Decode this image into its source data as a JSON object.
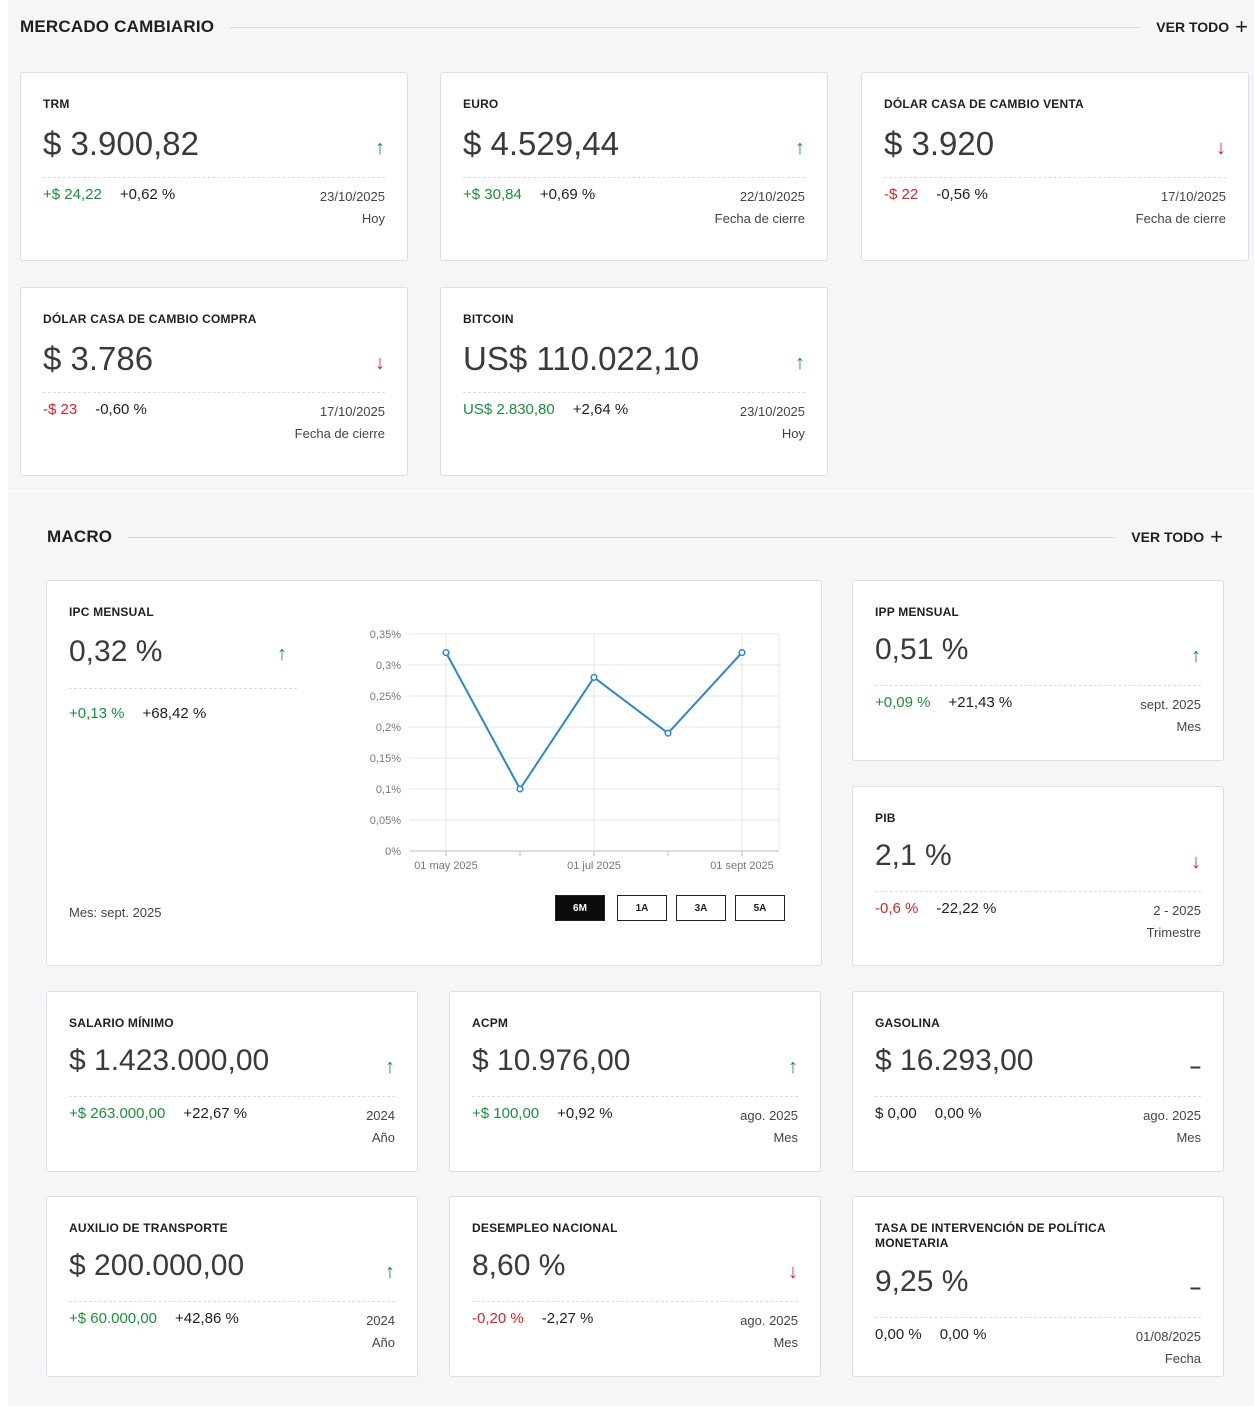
{
  "mercado": {
    "title": "MERCADO CAMBIARIO",
    "ver_todo": "VER TODO",
    "cards": [
      {
        "title": "TRM",
        "value": "$ 3.900,82",
        "trend": "up",
        "abs": "+$ 24,22",
        "pct": "+0,62 %",
        "date": "23/10/2025",
        "sub": "Hoy"
      },
      {
        "title": "EURO",
        "value": "$ 4.529,44",
        "trend": "up",
        "abs": "+$ 30,84",
        "pct": "+0,69 %",
        "date": "22/10/2025",
        "sub": "Fecha de cierre"
      },
      {
        "title": "DÓLAR CASA DE CAMBIO VENTA",
        "value": "$ 3.920",
        "trend": "down",
        "abs": "-$ 22",
        "pct": "-0,56 %",
        "date": "17/10/2025",
        "sub": "Fecha de cierre"
      },
      {
        "title": "DÓLAR CASA DE CAMBIO COMPRA",
        "value": "$ 3.786",
        "trend": "down",
        "abs": "-$ 23",
        "pct": "-0,60 %",
        "date": "17/10/2025",
        "sub": "Fecha de cierre"
      },
      {
        "title": "BITCOIN",
        "value": "US$ 110.022,10",
        "trend": "up",
        "abs": "US$ 2.830,80",
        "pct": "+2,64 %",
        "date": "23/10/2025",
        "sub": "Hoy"
      }
    ]
  },
  "macro": {
    "title": "MACRO",
    "ver_todo": "VER TODO",
    "ipc": {
      "title": "IPC MENSUAL",
      "value": "0,32 %",
      "trend": "up",
      "abs": "+0,13 %",
      "pct": "+68,42 %",
      "mes": "Mes: sept. 2025",
      "ranges": [
        "6M",
        "1A",
        "3A",
        "5A"
      ],
      "active_range": "6M"
    },
    "cards": [
      {
        "title": "IPP MENSUAL",
        "value": "0,51 %",
        "trend": "up",
        "abs": "+0,09 %",
        "pct": "+21,43 %",
        "date": "sept. 2025",
        "sub": "Mes"
      },
      {
        "title": "PIB",
        "value": "2,1 %",
        "trend": "down",
        "abs": "-0,6 %",
        "pct": "-22,22 %",
        "date": "2 - 2025",
        "sub": "Trimestre"
      },
      {
        "title": "SALARIO MÍNIMO",
        "value": "$ 1.423.000,00",
        "trend": "up",
        "abs": "+$ 263.000,00",
        "pct": "+22,67 %",
        "date": "2024",
        "sub": "Año"
      },
      {
        "title": "ACPM",
        "value": "$ 10.976,00",
        "trend": "up",
        "abs": "+$ 100,00",
        "pct": "+0,92 %",
        "date": "ago. 2025",
        "sub": "Mes"
      },
      {
        "title": "GASOLINA",
        "value": "$ 16.293,00",
        "trend": "flat",
        "abs": "$ 0,00",
        "pct": "0,00 %",
        "date": "ago. 2025",
        "sub": "Mes"
      },
      {
        "title": "AUXILIO DE TRANSPORTE",
        "value": "$ 200.000,00",
        "trend": "up",
        "abs": "+$ 60.000,00",
        "pct": "+42,86 %",
        "date": "2024",
        "sub": "Año"
      },
      {
        "title": "DESEMPLEO NACIONAL",
        "value": "8,60 %",
        "trend": "down",
        "abs": "-0,20 %",
        "pct": "-2,27 %",
        "date": "ago. 2025",
        "sub": "Mes"
      },
      {
        "title": "TASA DE INTERVENCIÓN DE POLÍTICA MONETARIA",
        "value": "9,25 %",
        "trend": "flat",
        "abs": "0,00 %",
        "pct": "0,00 %",
        "date": "01/08/2025",
        "sub": "Fecha"
      }
    ]
  },
  "chart_data": {
    "type": "line",
    "x": [
      "01 may 2025",
      "01 jun 2025",
      "01 jul 2025",
      "01 ago 2025",
      "01 sept 2025"
    ],
    "x_tick_labels": [
      "01 may 2025",
      "01 jul 2025",
      "01 sept 2025"
    ],
    "series": [
      {
        "values": [
          0.32,
          0.1,
          0.28,
          0.19,
          0.32
        ]
      }
    ],
    "y_tick_labels": [
      "0%",
      "0,05%",
      "0,1%",
      "0,15%",
      "0,2%",
      "0,25%",
      "0,3%",
      "0,35%"
    ],
    "ylim": [
      0,
      0.35
    ],
    "grid": true,
    "line_color": "#2f86c8"
  }
}
